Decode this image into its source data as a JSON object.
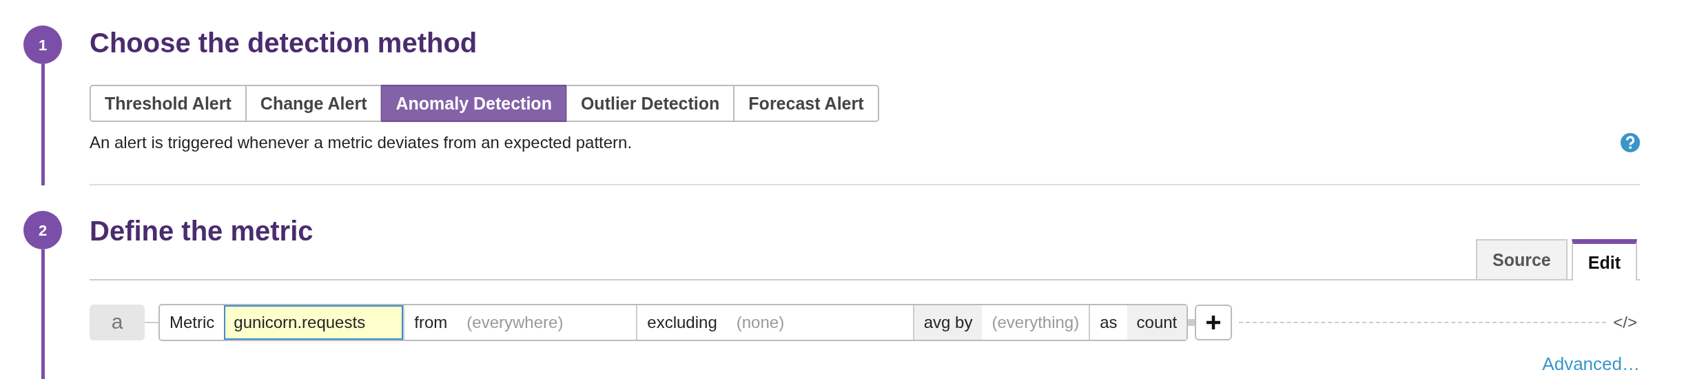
{
  "steps": [
    {
      "number": "1",
      "title": "Choose the detection method"
    },
    {
      "number": "2",
      "title": "Define the metric"
    }
  ],
  "method_tabs": [
    {
      "label": "Threshold Alert",
      "selected": false
    },
    {
      "label": "Change Alert",
      "selected": false
    },
    {
      "label": "Anomaly Detection",
      "selected": true
    },
    {
      "label": "Outlier Detection",
      "selected": false
    },
    {
      "label": "Forecast Alert",
      "selected": false
    }
  ],
  "description": "An alert is triggered whenever a metric deviates from an expected pattern.",
  "editor_tabs": [
    {
      "label": "Source",
      "selected": false
    },
    {
      "label": "Edit",
      "selected": true
    }
  ],
  "query": {
    "name": "a",
    "clauses": [
      {
        "kind": "metric",
        "keyword": "Metric",
        "value": "gunicorn.requests"
      },
      {
        "kind": "filter",
        "keyword": "from",
        "value": "(everywhere)"
      },
      {
        "kind": "filter",
        "keyword": "excluding",
        "value": "(none)"
      },
      {
        "kind": "group",
        "keyword": "avg by",
        "value": "(everything)"
      },
      {
        "kind": "type",
        "keyword": "as",
        "value": "count"
      }
    ],
    "code_toggle": "</>"
  },
  "advanced_link": "Advanced…"
}
